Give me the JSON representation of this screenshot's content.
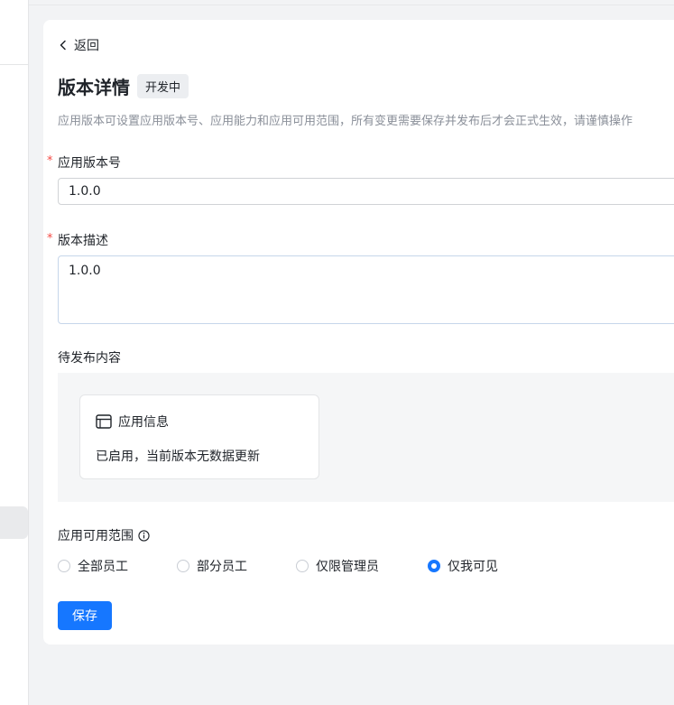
{
  "nav": {
    "back_label": "返回"
  },
  "header": {
    "title": "版本详情",
    "status_badge": "开发中"
  },
  "description": "应用版本可设置应用版本号、应用能力和应用可用范围，所有变更需要保存并发布后才会正式生效，请谨慎操作",
  "form": {
    "version_label": "应用版本号",
    "version_value": "1.0.0",
    "required_mark": "*",
    "desc_label": "版本描述",
    "desc_value": "1.0.0"
  },
  "pending": {
    "label": "待发布内容",
    "card_title": "应用信息",
    "card_body": "已启用，当前版本无数据更新"
  },
  "scope": {
    "label": "应用可用范围",
    "options": [
      {
        "label": "全部员工",
        "checked": false
      },
      {
        "label": "部分员工",
        "checked": false
      },
      {
        "label": "仅限管理员",
        "checked": false
      },
      {
        "label": "仅我可见",
        "checked": true
      }
    ]
  },
  "actions": {
    "save_label": "保存"
  },
  "colors": {
    "primary": "#1677ff",
    "required": "#f54a45"
  }
}
